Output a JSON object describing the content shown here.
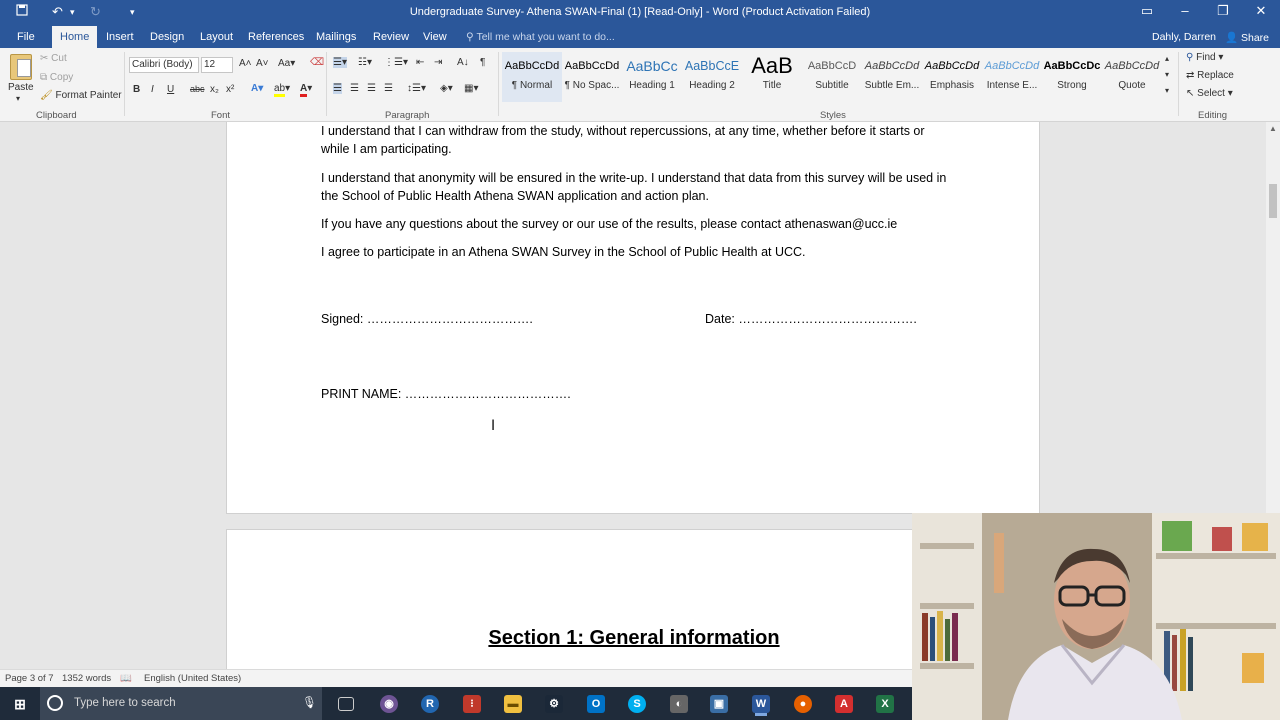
{
  "window": {
    "title": "Undergraduate Survey- Athena SWAN-Final (1) [Read-Only] - Word (Product Activation Failed)"
  },
  "tabs": [
    "File",
    "Home",
    "Insert",
    "Design",
    "Layout",
    "References",
    "Mailings",
    "Review",
    "View"
  ],
  "tell_me": "Tell me what you want to do...",
  "user": "Dahly, Darren",
  "share_label": "Share",
  "clipboard": {
    "paste": "Paste",
    "cut": "Cut",
    "copy": "Copy",
    "format_painter": "Format Painter",
    "group_label": "Clipboard"
  },
  "font": {
    "name": "Calibri (Body)",
    "size": "12",
    "group_label": "Font",
    "bold": "B",
    "italic": "I",
    "underline": "U",
    "strike": "abc",
    "sub": "x₂",
    "sup": "x²"
  },
  "paragraph": {
    "group_label": "Paragraph"
  },
  "styles": {
    "group_label": "Styles",
    "items": [
      {
        "preview": "AaBbCcDd",
        "name": "¶ Normal"
      },
      {
        "preview": "AaBbCcDd",
        "name": "¶ No Spac..."
      },
      {
        "preview": "AaBbCc",
        "name": "Heading 1"
      },
      {
        "preview": "AaBbCcE",
        "name": "Heading 2"
      },
      {
        "preview": "AaB",
        "name": "Title"
      },
      {
        "preview": "AaBbCcD",
        "name": "Subtitle"
      },
      {
        "preview": "AaBbCcDd",
        "name": "Subtle Em..."
      },
      {
        "preview": "AaBbCcDd",
        "name": "Emphasis"
      },
      {
        "preview": "AaBbCcDd",
        "name": "Intense E..."
      },
      {
        "preview": "AaBbCcDc",
        "name": "Strong"
      },
      {
        "preview": "AaBbCcDd",
        "name": "Quote"
      }
    ]
  },
  "editing": {
    "find": "Find",
    "replace": "Replace",
    "select": "Select",
    "group_label": "Editing"
  },
  "document": {
    "paragraphs": [
      "I understand that I can withdraw from the study, without repercussions, at any time, whether before it starts or while I am participating.",
      "I understand that anonymity will be ensured in the write-up.  I understand that data from this survey will be used in the School of Public Health Athena SWAN application and action plan.",
      "If you have any questions about the survey or our use of the results, please contact athenaswan@ucc.ie",
      "I agree to participate in an Athena SWAN Survey in the School of Public Health at UCC."
    ],
    "signed_line": "Signed:  ………………………………….",
    "date_line": "Date:   …………………………………….",
    "print_name_line": "PRINT NAME:    ………………………………….",
    "section_heading": "Section 1: General information"
  },
  "status": {
    "page": "Page 3 of 7",
    "words": "1352 words",
    "language": "English (United States)"
  },
  "taskbar": {
    "search_placeholder": "Type here to search"
  },
  "colors": {
    "word_blue": "#2b579a",
    "taskbar": "#1f2b3a"
  }
}
